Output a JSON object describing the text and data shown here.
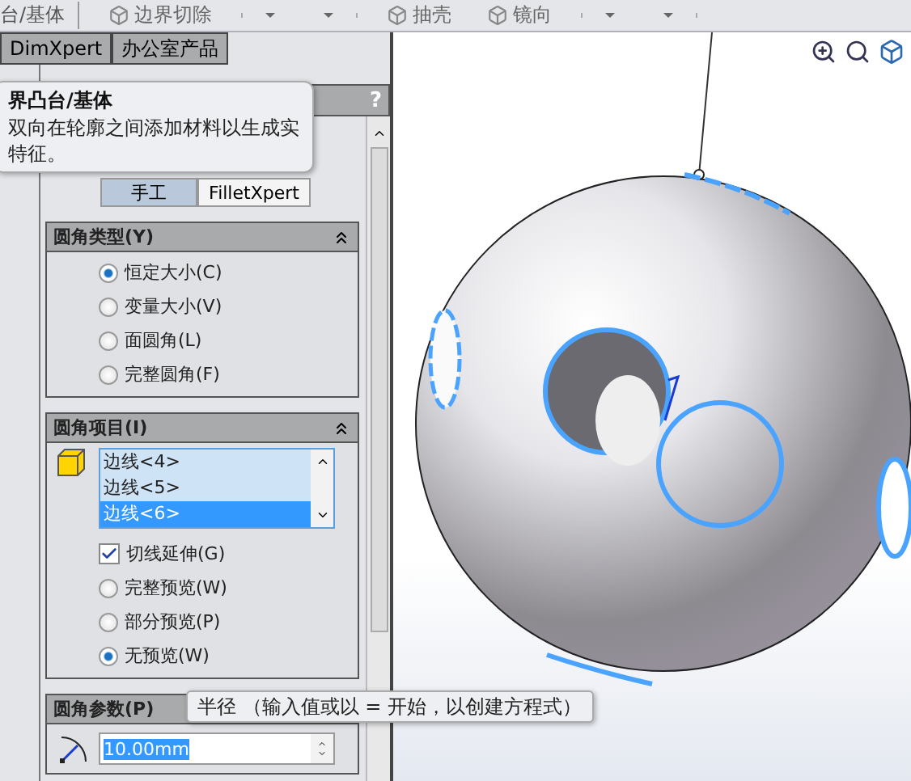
{
  "toolbar": {
    "items": [
      {
        "kind": "label",
        "label": "台/基体"
      },
      {
        "kind": "tool",
        "label": "边界切除"
      },
      {
        "kind": "dropdowns"
      },
      {
        "kind": "tool",
        "label": "抽壳"
      },
      {
        "kind": "tool",
        "label": "镜向"
      },
      {
        "kind": "dropdowns"
      }
    ]
  },
  "tabs": [
    {
      "label": "DimXpert",
      "selected": false
    },
    {
      "label": "办公室产品",
      "selected": false
    }
  ],
  "panel": {
    "help": "?",
    "mode_tabs": [
      {
        "label": "手工",
        "selected": true
      },
      {
        "label": "FilletXpert",
        "selected": false
      }
    ],
    "fillet_type": {
      "title": "圆角类型(Y)",
      "expanded": true,
      "options": [
        {
          "label": "恒定大小(C)",
          "selected": true
        },
        {
          "label": "变量大小(V)",
          "selected": false
        },
        {
          "label": "面圆角(L)",
          "selected": false
        },
        {
          "label": "完整圆角(F)",
          "selected": false
        }
      ]
    },
    "fillet_items": {
      "title": "圆角项目(I)",
      "expanded": true,
      "edges": [
        {
          "label": "边线<4>",
          "selected": false
        },
        {
          "label": "边线<5>",
          "selected": false
        },
        {
          "label": "边线<6>",
          "selected": true
        }
      ],
      "tangent_propagation": {
        "label": "切线延伸(G)",
        "checked": true
      },
      "preview": [
        {
          "label": "完整预览(W)",
          "selected": false
        },
        {
          "label": "部分预览(P)",
          "selected": false
        },
        {
          "label": "无预览(W)",
          "selected": true
        }
      ]
    },
    "fillet_parameters": {
      "title": "圆角参数(P)",
      "radius": "10.00mm"
    }
  },
  "tooltips": [
    {
      "title": "界凸台/基体",
      "lines": [
        "双向在轮廓之间添加材料以生成实",
        "特征。"
      ]
    },
    {
      "lines": [
        "半径 （输入值或以 = 开始，以创建方程式）"
      ]
    }
  ]
}
